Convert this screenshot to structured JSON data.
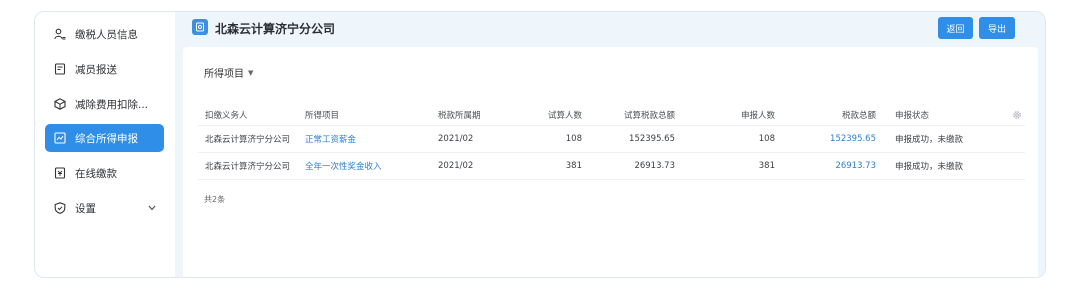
{
  "sidebar": {
    "items": [
      {
        "label": "缴税人员信息",
        "icon": "person-list-icon"
      },
      {
        "label": "减员报送",
        "icon": "clipboard-icon"
      },
      {
        "label": "减除费用扣除...",
        "icon": "cube-icon"
      },
      {
        "label": "综合所得申报",
        "icon": "chart-report-icon"
      },
      {
        "label": "在线缴款",
        "icon": "payment-icon"
      },
      {
        "label": "设置",
        "icon": "shield-settings-icon"
      }
    ],
    "active_index": 3
  },
  "header": {
    "company_title": "北森云计算济宁分公司",
    "back_label": "返回",
    "export_label": "导出"
  },
  "filter": {
    "label": "所得项目"
  },
  "table": {
    "columns": [
      "扣缴义务人",
      "所得项目",
      "税款所属期",
      "试算人数",
      "试算税款总额",
      "申报人数",
      "税款总额",
      "申报状态"
    ],
    "rows": [
      [
        "北森云计算济宁分公司",
        "正常工资薪金",
        "2021/02",
        "108",
        "152395.65",
        "108",
        "152395.65",
        "申报成功，未缴款"
      ],
      [
        "北森云计算济宁分公司",
        "全年一次性奖金收入",
        "2021/02",
        "381",
        "26913.73",
        "381",
        "26913.73",
        "申报成功，未缴款"
      ]
    ]
  },
  "total_text": "共2条",
  "colors": {
    "accent": "#2f8fe8",
    "link": "#2f7fd0",
    "page_bg": "#eef5fb"
  }
}
